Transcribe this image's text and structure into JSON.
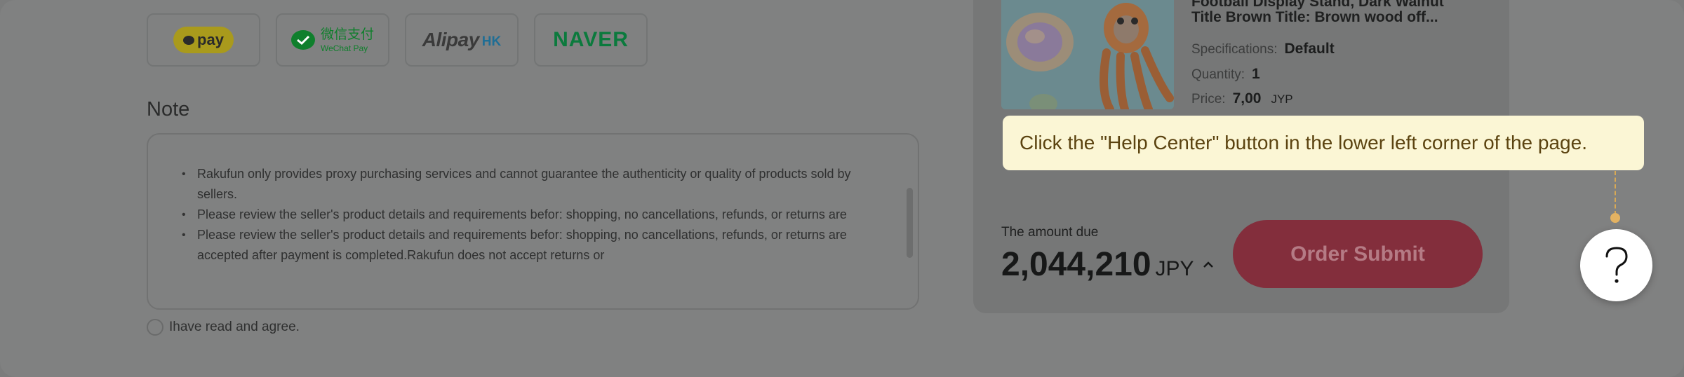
{
  "payment_methods": [
    {
      "id": "kakaopay",
      "label": "pay"
    },
    {
      "id": "wechat",
      "label_cn": "微信支付",
      "label_en": "WeChat Pay"
    },
    {
      "id": "alipayhk",
      "label": "Alipay",
      "suffix": "HK"
    },
    {
      "id": "naver",
      "label": "NAVER"
    }
  ],
  "note": {
    "title": "Note",
    "items": [
      "Rakufun only provides proxy purchasing services and cannot guarantee the authenticity or quality of products sold by sellers.",
      "Please review the seller's product details and requirements befor: shopping, no cancellations, refunds, or returns are",
      "Please review the seller's product details and requirements befor: shopping, no cancellations, refunds, or returns are accepted after payment is completed.Rakufun does not accept returns or"
    ],
    "agree_label": "Ihave read and agree."
  },
  "product": {
    "title": "Football Display Stand, Dark Walnut Title  Brown Title: Brown wood off...",
    "spec_label": "Specifications:",
    "spec_value": "Default",
    "qty_label": "Quantity:",
    "qty_value": "1",
    "price_label": "Price:",
    "price_value": "7,00",
    "price_currency": "JYP"
  },
  "summary": {
    "amount_label": "The amount due",
    "amount_value": "2,044,210",
    "amount_currency": "JPY",
    "submit_label": "Order Submit"
  },
  "tooltip": {
    "text": "Click the \"Help Center\" button in the lower left corner of the page."
  },
  "help_button": {
    "icon": "question-icon",
    "label": "?"
  },
  "colors": {
    "overlay": "#808181",
    "submit": "#832e3c",
    "tooltip_bg": "#fbf6d5",
    "tooltip_text": "#5b4310"
  }
}
